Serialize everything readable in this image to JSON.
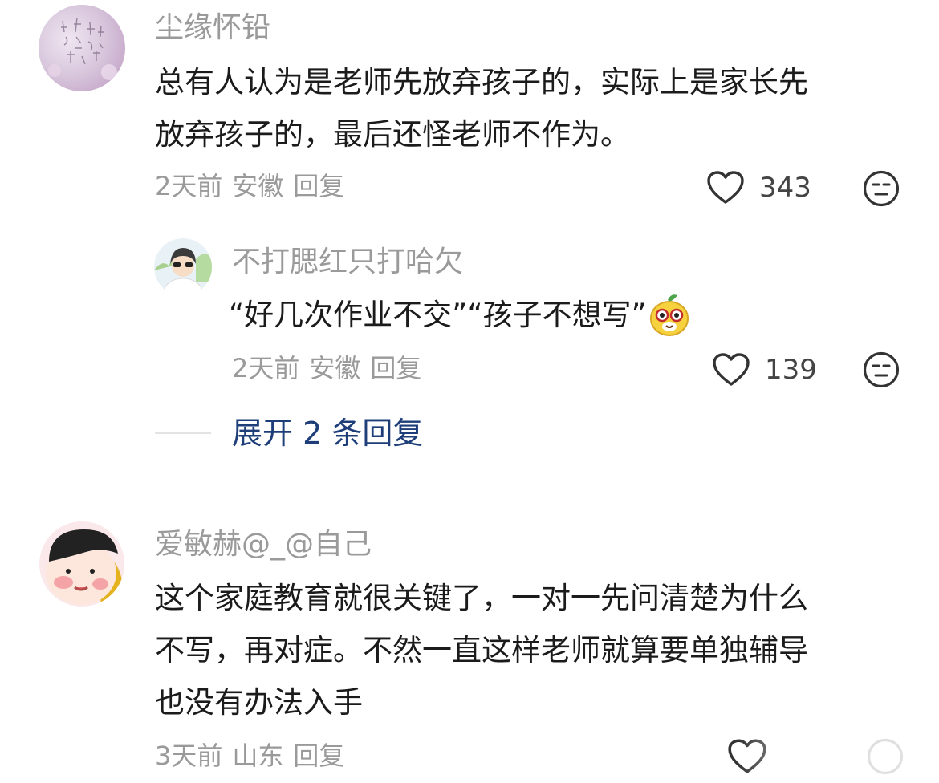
{
  "comments": [
    {
      "user": "尘缘怀铅",
      "text_lines": [
        "总有人认为是老师先放弃孩子的，实际上是家长先",
        "放弃孩子的，最后还怪老师不作为。"
      ],
      "time": "2天前",
      "location": "安徽",
      "reply_label": "回复",
      "likes": "343",
      "reply": {
        "user": "不打腮红只打哈欠",
        "text": "“好几次作业不交”“孩子不想写”",
        "time": "2天前",
        "location": "安徽",
        "reply_label": "回复",
        "likes": "139"
      },
      "expand_label": "展开 2 条回复"
    },
    {
      "user": "爱敏赫@_@自己",
      "text_lines": [
        "这个家庭教育就很关键了，一对一先问清楚为什么",
        "不写，再对症。不然一直这样老师就算要单独辅导",
        "也没有办法入手"
      ],
      "time": "3天前",
      "location": "山东",
      "reply_label": "回复"
    }
  ],
  "icons": {
    "like": "heart-outline-icon",
    "dislike": "meh-face-icon",
    "emoji": "cartoon-face-emoji"
  }
}
